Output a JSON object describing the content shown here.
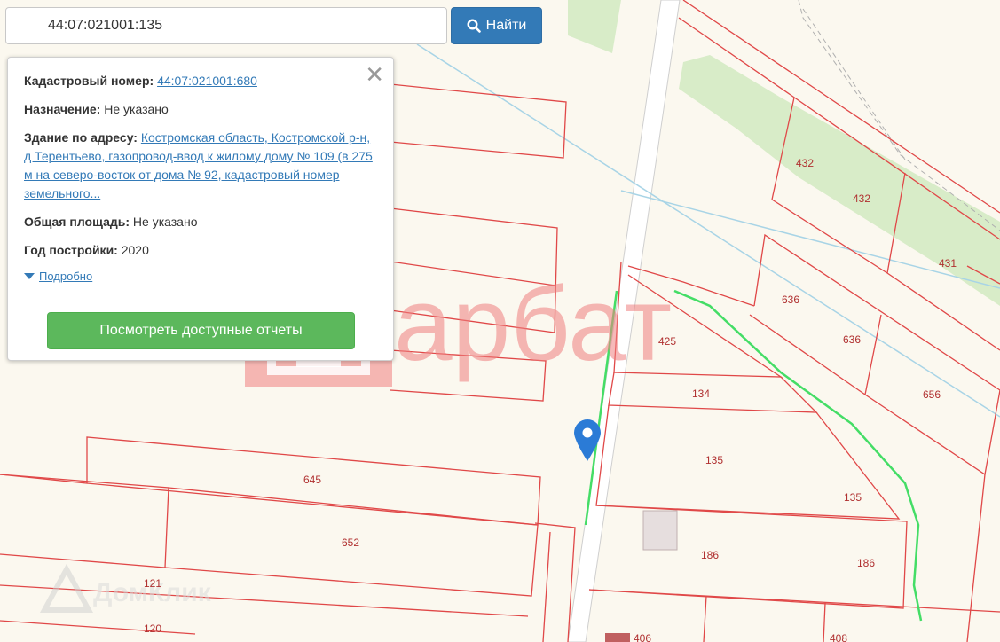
{
  "search": {
    "value": "44:07:021001:135",
    "button_label": "Найти"
  },
  "popup": {
    "cadastral_label": "Кадастровый номер:",
    "cadastral_value": "44:07:021001:680",
    "purpose_label": "Назначение:",
    "purpose_value": "Не указано",
    "building_label": "Здание по адресу:",
    "building_value": "Костромская область, Костромской р-н, д Терентьево, газопровод-ввод к жилому дому № 109 (в 275 м на северо-восток от дома № 92, кадастровый номер земельного...",
    "area_label": "Общая площадь:",
    "area_value": "Не указано",
    "year_label": "Год постройки:",
    "year_value": "2020",
    "details_link": "Подробно",
    "report_button": "Посмотреть доступные отчеты",
    "close_icon": "close-icon"
  },
  "watermarks": {
    "arbat_text": "арбат",
    "domclick_text": "ДомКлик"
  },
  "plot_labels": [
    "432",
    "432",
    "431",
    "636",
    "636",
    "656",
    "425",
    "134",
    "135",
    "135",
    "186",
    "186",
    "645",
    "652",
    "121",
    "120",
    "406",
    "408"
  ],
  "colors": {
    "map_background": "#fbf8ef",
    "parcel_border": "#e04848",
    "green_strip": "#d8ecc8",
    "pipeline": "#44dd66",
    "pin": "#2b7bd6",
    "search_button": "#337ab7",
    "report_button": "#5cb85c"
  }
}
